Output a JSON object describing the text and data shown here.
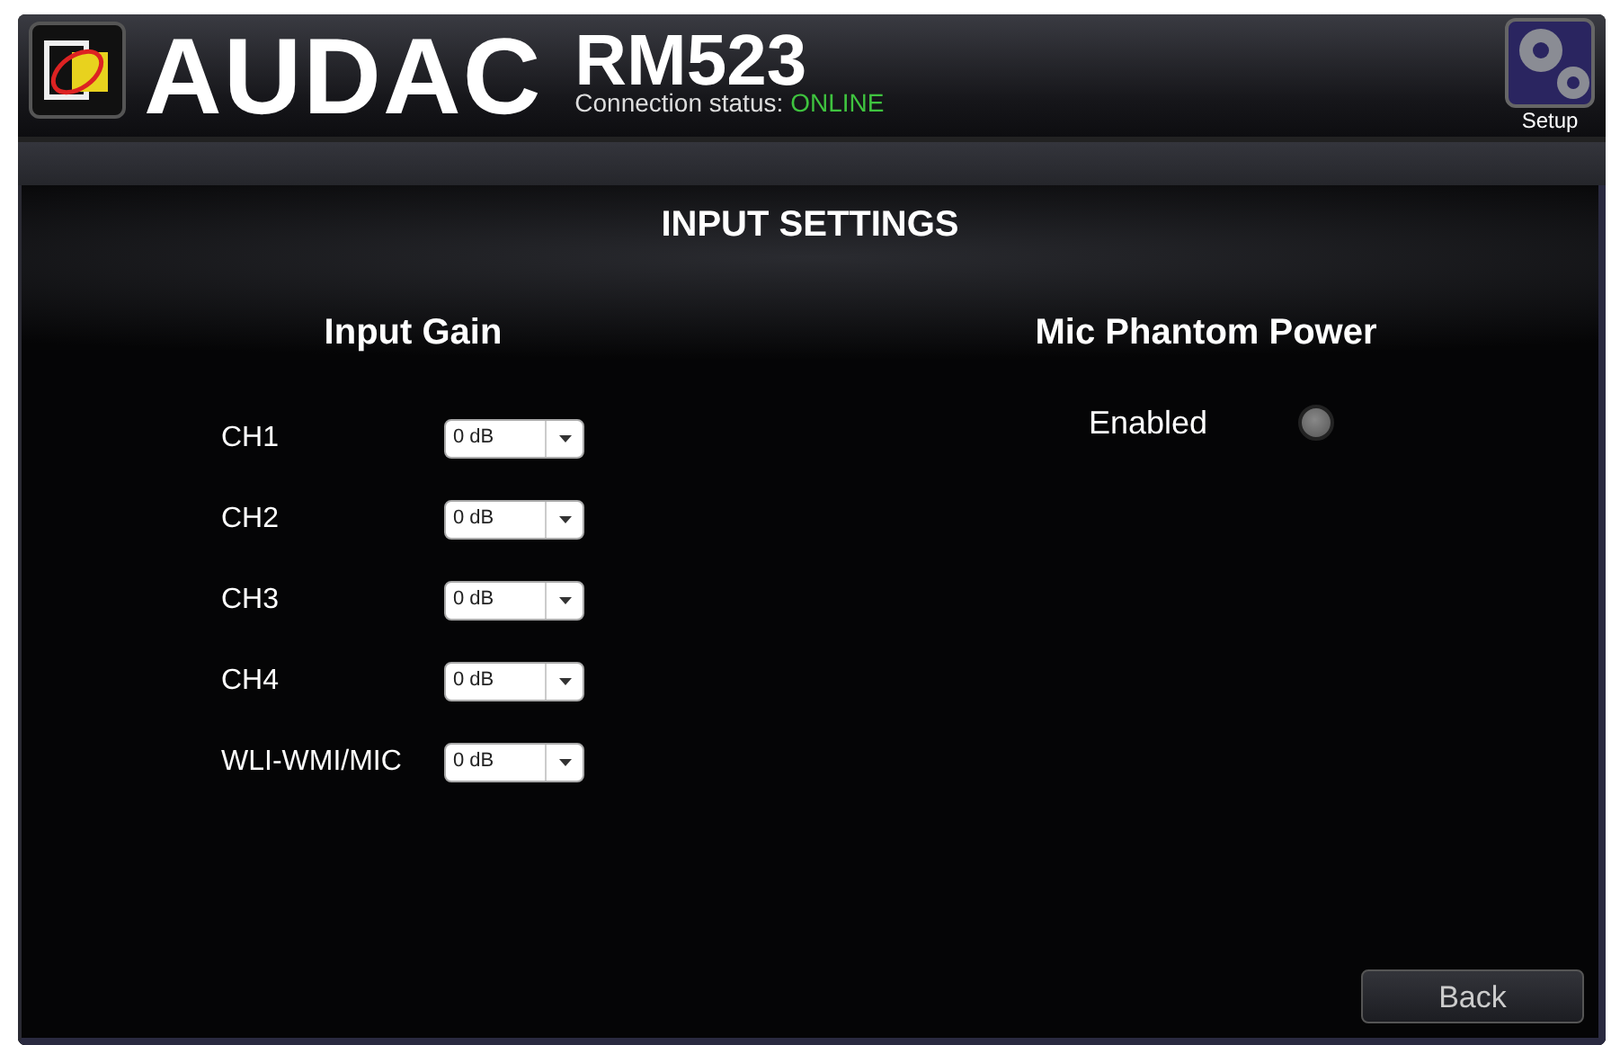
{
  "header": {
    "brand": "AUDAC",
    "model": "RM523",
    "status_label": "Connection status:",
    "status_value": "ONLINE",
    "online": true,
    "setup_button": "Setup"
  },
  "page_title": "INPUT SETTINGS",
  "input_gain": {
    "title": "Input Gain",
    "channels": [
      {
        "name": "CH1",
        "value": "0 dB"
      },
      {
        "name": "CH2",
        "value": "0 dB"
      },
      {
        "name": "CH3",
        "value": "0 dB"
      },
      {
        "name": "CH4",
        "value": "0 dB"
      },
      {
        "name": "WLI-WMI/MIC",
        "value": "0 dB"
      }
    ]
  },
  "phantom_power": {
    "title": "Mic Phantom Power",
    "label": "Enabled",
    "on": false
  },
  "back_button": "Back"
}
